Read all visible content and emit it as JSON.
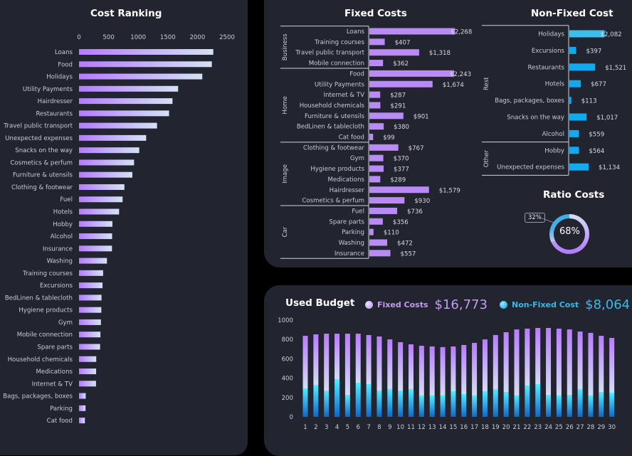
{
  "colors": {
    "background": "#000000",
    "panel": "#22242f",
    "fixed_bar": "#bb8bf5",
    "nonfixed_bar": "#12aaec",
    "nonfixed_highlight": "#3fbfe8",
    "rank_grad_start": "#b57bff",
    "rank_grad_end": "#d3e2f3",
    "budget_fixed_top": "#b97cff",
    "budget_fixed_bottom": "#d4dcf2",
    "budget_non_top": "#54ecff",
    "budget_non_bottom": "#1166c8",
    "legend_fixed": "#c39cf3",
    "legend_nonfixed": "#3bb8e8"
  },
  "chart_data": [
    {
      "id": "cost-ranking",
      "type": "bar",
      "orientation": "horizontal",
      "title": "Cost Ranking",
      "xlim": [
        0,
        2500
      ],
      "xticks": [
        0,
        500,
        1000,
        1500,
        2000,
        2500
      ],
      "categories": [
        "Loans",
        "Food",
        "Holidays",
        "Utility Payments",
        "Hairdresser",
        "Restaurants",
        "Travel public transport",
        "Unexpected expenses",
        "Snacks on the way",
        "Cosmetics & perfum",
        "Furniture & utensils",
        "Clothing & footwear",
        "Fuel",
        "Hotels",
        "Hobby",
        "Alcohol",
        "Insurance",
        "Washing",
        "Training courses",
        "Excursions",
        "BedLinen & tablecloth",
        "Hygiene products",
        "Gym",
        "Mobile connection",
        "Spare parts",
        "Household chemicals",
        "Medications",
        "Internet & TV",
        "Bags, packages, boxes",
        "Parking",
        "Cat food"
      ],
      "values": [
        2268,
        2243,
        2082,
        1674,
        1579,
        1521,
        1318,
        1134,
        1017,
        930,
        901,
        767,
        736,
        677,
        564,
        559,
        557,
        472,
        407,
        397,
        380,
        377,
        370,
        362,
        356,
        291,
        289,
        287,
        113,
        110,
        99
      ]
    },
    {
      "id": "fixed-costs",
      "type": "bar",
      "orientation": "horizontal",
      "title": "Fixed Costs",
      "groups": [
        {
          "name": "Business",
          "items": [
            [
              "Loans",
              2268,
              "$2,268"
            ],
            [
              "Training courses",
              407,
              "$407"
            ],
            [
              "Travel public transport",
              1318,
              "$1,318"
            ],
            [
              "Mobile connection",
              362,
              "$362"
            ]
          ]
        },
        {
          "name": "Home",
          "items": [
            [
              "Food",
              2243,
              "$2,243"
            ],
            [
              "Utility Payments",
              1674,
              "$1,674"
            ],
            [
              "Internet & TV",
              287,
              "$287"
            ],
            [
              "Household chemicals",
              291,
              "$291"
            ],
            [
              "Furniture & utensils",
              901,
              "$901"
            ],
            [
              "BedLinen & tablecloth",
              380,
              "$380"
            ],
            [
              "Cat food",
              99,
              "$99"
            ]
          ]
        },
        {
          "name": "Image",
          "items": [
            [
              "Clothing & footwear",
              767,
              "$767"
            ],
            [
              "Gym",
              370,
              "$370"
            ],
            [
              "Hygiene products",
              377,
              "$377"
            ],
            [
              "Medications",
              289,
              "$289"
            ],
            [
              "Hairdresser",
              1579,
              "$1,579"
            ],
            [
              "Cosmetics & perfum",
              930,
              "$930"
            ]
          ]
        },
        {
          "name": "Car",
          "items": [
            [
              "Fuel",
              736,
              "$736"
            ],
            [
              "Spare parts",
              356,
              "$356"
            ],
            [
              "Parking",
              110,
              "$110"
            ],
            [
              "Washing",
              472,
              "$472"
            ],
            [
              "Insurance",
              557,
              "$557"
            ]
          ]
        }
      ],
      "xlim": [
        0,
        2300
      ]
    },
    {
      "id": "non-fixed-cost",
      "type": "bar",
      "orientation": "horizontal",
      "title": "Non-Fixed Cost",
      "groups": [
        {
          "name": "Rest",
          "items": [
            [
              "Holidays",
              2082,
              "$2,082"
            ],
            [
              "Excursions",
              397,
              "$397"
            ],
            [
              "Restaurants",
              1521,
              "$1,521"
            ],
            [
              "Hotels",
              677,
              "$677"
            ],
            [
              "Bags, packages, boxes",
              113,
              "$113"
            ],
            [
              "Snacks on the way",
              1017,
              "$1,017"
            ],
            [
              "Alcohol",
              559,
              "$559"
            ]
          ]
        },
        {
          "name": "Other",
          "items": [
            [
              "Hobby",
              564,
              "$564"
            ],
            [
              "Unexpected expenses",
              1134,
              "$1,134"
            ]
          ]
        }
      ],
      "xlim": [
        0,
        2100
      ]
    },
    {
      "id": "ratio-costs",
      "type": "pie",
      "title": "Ratio Costs",
      "slices": [
        {
          "name": "Fixed Costs",
          "value": 68,
          "label": "68%"
        },
        {
          "name": "Non-Fixed Cost",
          "value": 32,
          "label": "32%"
        }
      ]
    },
    {
      "id": "used-budget",
      "type": "bar",
      "stacked": true,
      "title": "Used Budget",
      "x": [
        1,
        2,
        3,
        4,
        5,
        6,
        7,
        8,
        9,
        10,
        11,
        12,
        13,
        14,
        15,
        16,
        17,
        18,
        19,
        20,
        21,
        22,
        23,
        24,
        25,
        26,
        27,
        28,
        29,
        30
      ],
      "ylim": [
        0,
        1000
      ],
      "yticks": [
        0,
        200,
        400,
        600,
        800,
        1000
      ],
      "series": [
        {
          "name": "Non-Fixed Cost",
          "values": [
            294,
            331,
            272,
            390,
            228,
            353,
            338,
            272,
            287,
            272,
            287,
            221,
            221,
            221,
            265,
            235,
            221,
            265,
            287,
            257,
            221,
            324,
            338,
            228,
            221,
            228,
            287,
            221,
            257,
            250
          ]
        },
        {
          "name": "Fixed Costs",
          "values": [
            544,
            522,
            588,
            470,
            632,
            507,
            508,
            559,
            514,
            500,
            463,
            514,
            507,
            500,
            463,
            508,
            544,
            536,
            559,
            618,
            683,
            588,
            581,
            691,
            691,
            676,
            595,
            647,
            581,
            566
          ]
        }
      ]
    }
  ],
  "budget_legend": {
    "fixed_label": "Fixed Costs",
    "fixed_total": "$16,773",
    "nonfixed_label": "Non-Fixed Cost",
    "nonfixed_total": "$8,064"
  },
  "ratio": {
    "center_label": "68%",
    "callout_label": "32%"
  }
}
